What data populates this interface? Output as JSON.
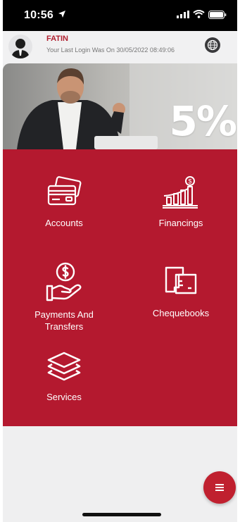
{
  "status_bar": {
    "time": "10:56"
  },
  "header": {
    "user_name": "FATIN",
    "last_login": "Your Last Login Was On 30/05/2022 08:49:06"
  },
  "banner": {
    "promo_text": "5%"
  },
  "menu": {
    "accounts": "Accounts",
    "financings": "Financings",
    "payments_line1": "Payments And",
    "payments_line2": "Transfers",
    "chequebooks": "Chequebooks",
    "services": "Services"
  },
  "colors": {
    "brand_red": "#b4192f",
    "fab_red": "#c0202f"
  }
}
